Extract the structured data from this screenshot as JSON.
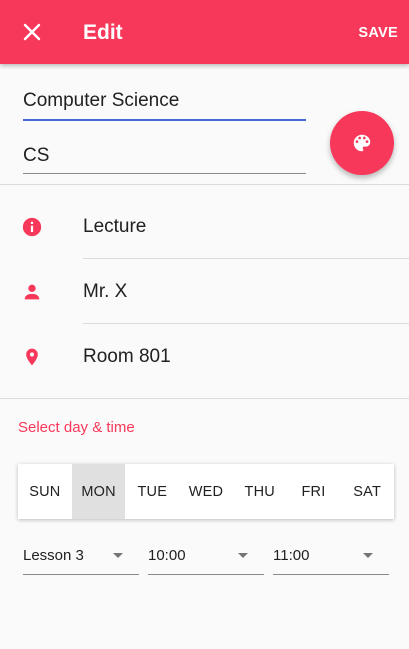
{
  "appbar": {
    "title": "Edit",
    "save_label": "SAVE",
    "close_icon": "close-icon",
    "color": "#f8385a"
  },
  "form": {
    "name": "Computer Science",
    "abbreviation": "CS",
    "color_button_icon": "palette-icon"
  },
  "details": [
    {
      "icon": "info-icon",
      "label": "Lecture"
    },
    {
      "icon": "person-icon",
      "label": "Mr. X"
    },
    {
      "icon": "location-pin-icon",
      "label": "Room 801"
    }
  ],
  "schedule": {
    "section_title": "Select day & time",
    "days": [
      "SUN",
      "MON",
      "TUE",
      "WED",
      "THU",
      "FRI",
      "SAT"
    ],
    "selected_day": "MON",
    "lesson": "Lesson 3",
    "start_time": "10:00",
    "end_time": "11:00"
  },
  "colors": {
    "accent": "#f8385a",
    "focus_underline": "#4a68d6",
    "selected_day_bg": "#e0e0e0"
  }
}
